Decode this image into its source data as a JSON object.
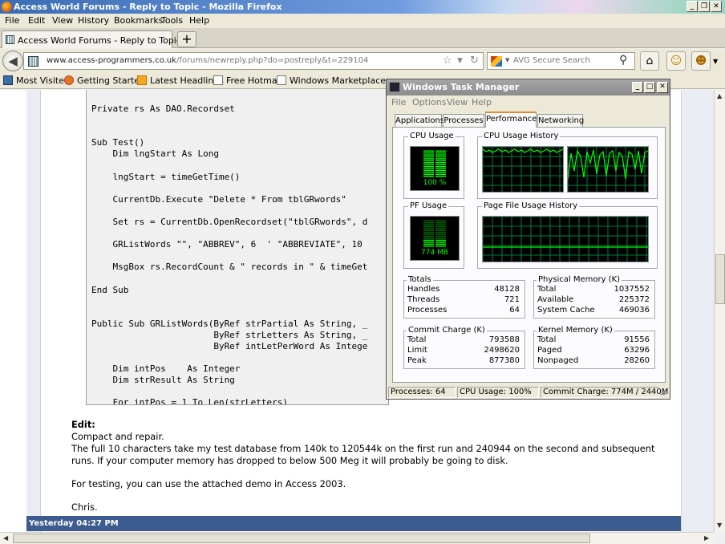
{
  "browser": {
    "window_title": "Access World Forums - Reply to Topic - Mozilla Firefox",
    "menu": [
      "File",
      "Edit",
      "View",
      "History",
      "Bookmarks",
      "Tools",
      "Help"
    ],
    "tab_label": "Access World Forums - Reply to Topic",
    "new_tab": "+",
    "url_domain": "www.access-programmers.co.uk",
    "url_path": "/forums/newreply.php?do=postreply&t=229104",
    "search_placeholder": "AVG Secure Search",
    "bookmarks": [
      "Most Visited",
      "Getting Started",
      "Latest Headlines",
      "Free Hotmail",
      "Windows Marketplace"
    ]
  },
  "forum": {
    "code_lines": [
      "Private rs As DAO.Recordset",
      "",
      "",
      "Sub Test()",
      "    Dim lngStart As Long",
      "",
      "    lngStart = timeGetTime()",
      "",
      "    CurrentDb.Execute \"Delete * From tblGRwords\"",
      "",
      "    Set rs = CurrentDb.OpenRecordset(\"tblGRwords\", d",
      "",
      "    GRListWords \"\", \"ABBREV\", 6  ' \"ABBREVIATE\", 10",
      "",
      "    MsgBox rs.RecordCount & \" records in \" & timeGet",
      "",
      "End Sub",
      "",
      "",
      "Public Sub GRListWords(ByRef strPartial As String, _",
      "                       ByRef strLetters As String, _",
      "                       ByRef intLetPerWord As Intege",
      "",
      "    Dim intPos    As Integer",
      "    Dim strResult As String",
      "",
      "    For intPos = 1 To Len(strLetters)"
    ],
    "edit_label": "Edit:",
    "edit_line1": "Compact and repair.",
    "edit_line2": "The full 10 characters take my test database from 140k to 120544k on the first run and 240944 on the second and subsequent runs. If your computer memory has dropped to below 500 Meg it will probably be going to disk.",
    "edit_line3": "For testing, you can use the attached demo in Access 2003.",
    "signature": "Chris.",
    "post_date": "Yesterday 04:27 PM"
  },
  "taskmgr": {
    "title": "Windows Task Manager",
    "menu": [
      "File",
      "Options",
      "View",
      "Help"
    ],
    "tabs": [
      "Applications",
      "Processes",
      "Performance",
      "Networking"
    ],
    "active_tab": "Performance",
    "cpu_usage_title": "CPU Usage",
    "cpu_usage_value": "100 %",
    "cpu_usage_fraction": 1.0,
    "cpu_history_title": "CPU Usage History",
    "pf_usage_title": "PF Usage",
    "pf_usage_value": "774 MB",
    "pf_usage_fraction": 0.3,
    "pf_history_title": "Page File Usage History",
    "totals": {
      "title": "Totals",
      "rows": [
        [
          "Handles",
          "48128"
        ],
        [
          "Threads",
          "721"
        ],
        [
          "Processes",
          "64"
        ]
      ]
    },
    "physical": {
      "title": "Physical Memory (K)",
      "rows": [
        [
          "Total",
          "1037552"
        ],
        [
          "Available",
          "225372"
        ],
        [
          "System Cache",
          "469036"
        ]
      ]
    },
    "commit": {
      "title": "Commit Charge (K)",
      "rows": [
        [
          "Total",
          "793588"
        ],
        [
          "Limit",
          "2498620"
        ],
        [
          "Peak",
          "877380"
        ]
      ]
    },
    "kernel": {
      "title": "Kernel Memory (K)",
      "rows": [
        [
          "Total",
          "91556"
        ],
        [
          "Paged",
          "63296"
        ],
        [
          "Nonpaged",
          "28260"
        ]
      ]
    },
    "status": [
      "Processes: 64",
      "CPU Usage: 100%",
      "Commit Charge: 774M / 2440M"
    ],
    "colors": {
      "graph_line": "#00ff00",
      "grid": "#008040",
      "meter_off": "#006a00"
    }
  }
}
